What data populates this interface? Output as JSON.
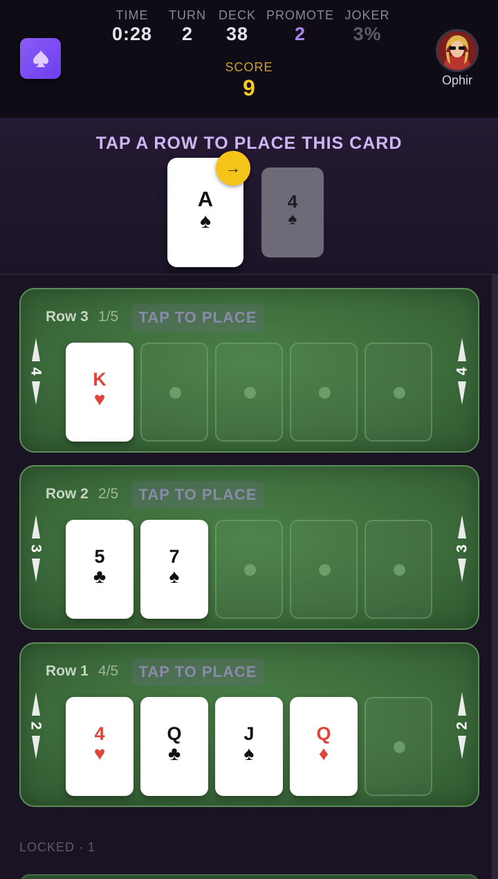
{
  "header": {
    "stats": [
      {
        "label": "TIME",
        "value": "0:28"
      },
      {
        "label": "TURN",
        "value": "2"
      },
      {
        "label": "DECK",
        "value": "38"
      },
      {
        "label": "PROMOTE",
        "value": "2"
      },
      {
        "label": "JOKER",
        "value": "3%"
      }
    ],
    "score": {
      "label": "SCORE",
      "value": "9"
    },
    "player": {
      "name": "Ophir"
    },
    "logo_icon": "spade-icon"
  },
  "placement": {
    "instruction": "TAP A ROW TO PLACE THIS CARD",
    "current_card": {
      "rank": "A",
      "suit": "♠"
    },
    "next_badge": "→",
    "next_card": {
      "rank": "4",
      "suit": "♠"
    }
  },
  "rows": [
    {
      "title": "Row 3",
      "count": "1/5",
      "tap_label": "TAP TO PLACE",
      "multiplier": "4",
      "slots": [
        {
          "rank": "K",
          "suit": "♥",
          "color": "red"
        },
        null,
        null,
        null,
        null
      ]
    },
    {
      "title": "Row 2",
      "count": "2/5",
      "tap_label": "TAP TO PLACE",
      "multiplier": "3",
      "slots": [
        {
          "rank": "5",
          "suit": "♣",
          "color": "black"
        },
        {
          "rank": "7",
          "suit": "♠",
          "color": "black"
        },
        null,
        null,
        null
      ]
    },
    {
      "title": "Row 1",
      "count": "4/5",
      "tap_label": "TAP TO PLACE",
      "multiplier": "2",
      "slots": [
        {
          "rank": "4",
          "suit": "♥",
          "color": "red"
        },
        {
          "rank": "Q",
          "suit": "♣",
          "color": "black"
        },
        {
          "rank": "J",
          "suit": "♠",
          "color": "black"
        },
        {
          "rank": "Q",
          "suit": "♦",
          "color": "red"
        },
        null
      ]
    }
  ],
  "locked": {
    "label": "LOCKED · 1"
  },
  "colors": {
    "accent_purple": "#8b5cf6",
    "score_gold": "#f6c928",
    "felt_green": "#3c6b3b",
    "red_suit": "#e0433a"
  }
}
